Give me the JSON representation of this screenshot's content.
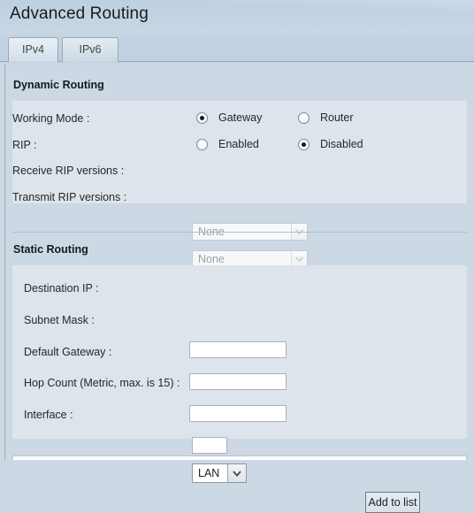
{
  "header": {
    "title": "Advanced Routing"
  },
  "tabs": [
    {
      "id": "ipv4",
      "label": "IPv4",
      "active": true
    },
    {
      "id": "ipv6",
      "label": "IPv6",
      "active": false
    }
  ],
  "dynamic_routing": {
    "heading": "Dynamic Routing",
    "working_mode": {
      "label": "Working Mode :",
      "options": [
        {
          "label": "Gateway",
          "selected": true
        },
        {
          "label": "Router",
          "selected": false
        }
      ]
    },
    "rip": {
      "label": "RIP :",
      "options": [
        {
          "label": "Enabled",
          "selected": false
        },
        {
          "label": "Disabled",
          "selected": true
        }
      ]
    },
    "receive_rip_versions": {
      "label": "Receive RIP versions :",
      "value": "None",
      "disabled": true
    },
    "transmit_rip_versions": {
      "label": "Transmit RIP versions :",
      "value": "None",
      "disabled": true
    }
  },
  "static_routing": {
    "heading": "Static Routing",
    "destination_ip": {
      "label": "Destination IP :",
      "value": "",
      "placeholder": ""
    },
    "subnet_mask": {
      "label": "Subnet Mask :",
      "value": "",
      "placeholder": ""
    },
    "default_gateway": {
      "label": "Default Gateway :",
      "value": "",
      "placeholder": ""
    },
    "hop_count": {
      "label": "Hop Count (Metric, max. is 15) :",
      "value": "",
      "placeholder": ""
    },
    "interface": {
      "label": "Interface :",
      "value": "LAN",
      "disabled": false
    }
  },
  "actions": {
    "add_to_list": "Add to list"
  },
  "colors": {
    "page_background": "#ccd8e4",
    "header_background": "#c3d3e3",
    "block_background": "#dde4eb",
    "text": "#25272b",
    "rule": "#9fadba"
  }
}
